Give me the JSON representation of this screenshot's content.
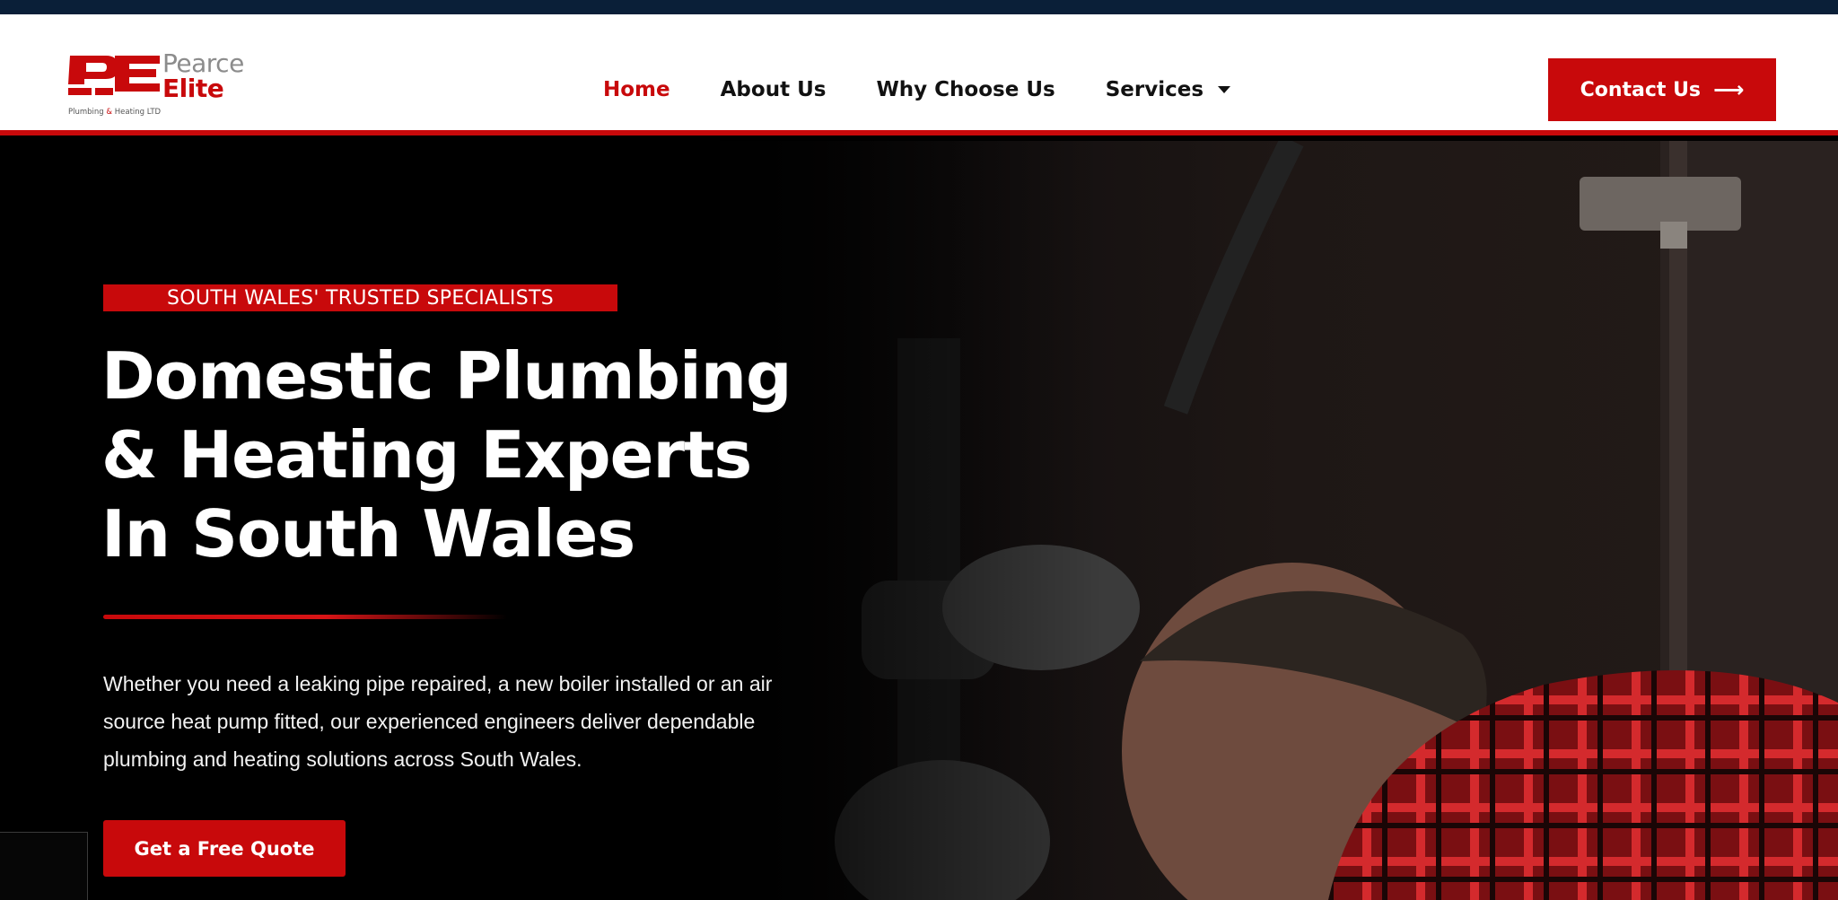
{
  "logo": {
    "mark": "PE",
    "word1": "Pearce",
    "word2": "Elite",
    "tagline_a": "Plumbing",
    "tagline_amp": "&",
    "tagline_b": "Heating LTD"
  },
  "nav": {
    "items": [
      {
        "label": "Home",
        "active": true
      },
      {
        "label": "About Us",
        "active": false
      },
      {
        "label": "Why Choose Us",
        "active": false
      },
      {
        "label": "Services",
        "active": false,
        "dropdown": true
      }
    ]
  },
  "header": {
    "contact_label": "Contact Us",
    "contact_icon": "arrow-right-icon"
  },
  "hero": {
    "badge": "SOUTH WALES' TRUSTED SPECIALISTS",
    "title": "Domestic Plumbing\n& Heating Experts\nIn South Wales",
    "description": "Whether you need a leaking pipe repaired, a new boiler installed or an air source heat pump fitted, our experienced engineers deliver dependable plumbing and heating solutions across South Wales.",
    "cta_label": "Get a Free Quote"
  },
  "colors": {
    "brand_red": "#c8090b",
    "top_bar": "#0a1f38",
    "nav_text": "#111111",
    "hero_bg": "#050505"
  }
}
